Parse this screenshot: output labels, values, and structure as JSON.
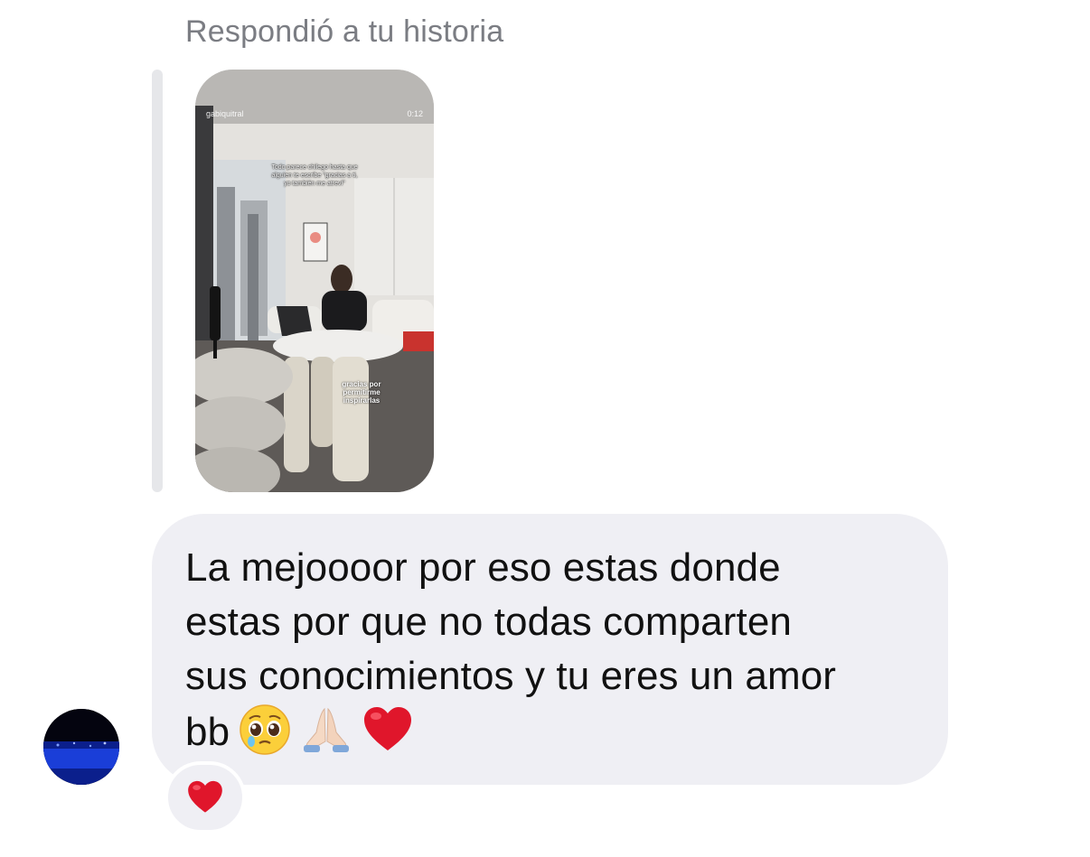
{
  "reply_header": "Respondió a tu historia",
  "story": {
    "username": "gabiquitral",
    "time": "0:12",
    "caption_top": "Todo parece chilego hasta que alguien te escribe \"gracias a ti, yo también me atreví\"",
    "caption_bottom": "gracias por permitirme inspirarlas"
  },
  "message": {
    "text": "La mejoooor por eso estas donde\nestas por que no todas comparten\nsus conocimientos y tu eres un amor\nbb",
    "emojis": [
      "pleading-face-icon",
      "folded-hands-icon",
      "red-heart-icon"
    ]
  },
  "reaction": {
    "emoji": "red-heart-icon"
  },
  "colors": {
    "bubble": "#efeff4",
    "header_text": "#7b7d83",
    "quote_bar": "#e6e7ea",
    "heart": "#e0162b"
  }
}
